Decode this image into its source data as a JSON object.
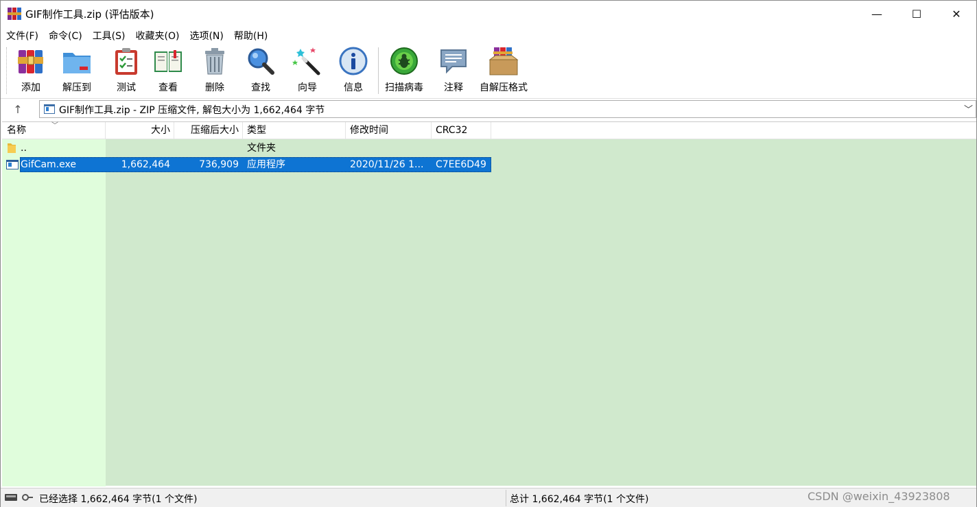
{
  "window": {
    "title": "GIF制作工具.zip (评估版本)",
    "controls": {
      "minimize": "—",
      "maximize": "☐",
      "close": "✕"
    }
  },
  "menu": [
    "文件(F)",
    "命令(C)",
    "工具(S)",
    "收藏夹(O)",
    "选项(N)",
    "帮助(H)"
  ],
  "toolbar": {
    "buttons": [
      {
        "label": "添加",
        "icon": "winrar-books-icon"
      },
      {
        "label": "解压到",
        "icon": "folder-extract-icon"
      },
      {
        "label": "测试",
        "icon": "clipboard-check-icon"
      },
      {
        "label": "查看",
        "icon": "open-book-icon"
      },
      {
        "label": "删除",
        "icon": "trash-can-icon"
      },
      {
        "label": "查找",
        "icon": "magnifier-icon"
      },
      {
        "label": "向导",
        "icon": "magic-wand-icon"
      },
      {
        "label": "信息",
        "icon": "info-icon"
      },
      {
        "label": "扫描病毒",
        "icon": "virus-scan-icon"
      },
      {
        "label": "注释",
        "icon": "comment-icon"
      },
      {
        "label": "自解压格式",
        "icon": "sfx-box-icon"
      }
    ]
  },
  "address": {
    "text": "GIF制作工具.zip - ZIP 压缩文件, 解包大小为 1,662,464 字节"
  },
  "columns": [
    "名称",
    "大小",
    "压缩后大小",
    "类型",
    "修改时间",
    "CRC32"
  ],
  "rows": [
    {
      "name": "..",
      "size": "",
      "packed": "",
      "type": "文件夹",
      "modified": "",
      "crc": "",
      "icon": "folder-icon",
      "selected": false
    },
    {
      "name": "GifCam.exe",
      "size": "1,662,464",
      "packed": "736,909",
      "type": "应用程序",
      "modified": "2020/11/26 1...",
      "crc": "C7EE6D49",
      "icon": "exe-icon",
      "selected": true
    }
  ],
  "status": {
    "selected": "已经选择 1,662,464 字节(1 个文件)",
    "total": "总计 1,662,464 字节(1 个文件)"
  },
  "watermark": "CSDN @weixin_43923808",
  "colors": {
    "list_background": "#d0e9cd",
    "name_column_background": "#e0fddc",
    "selection": "#0e74d3"
  }
}
